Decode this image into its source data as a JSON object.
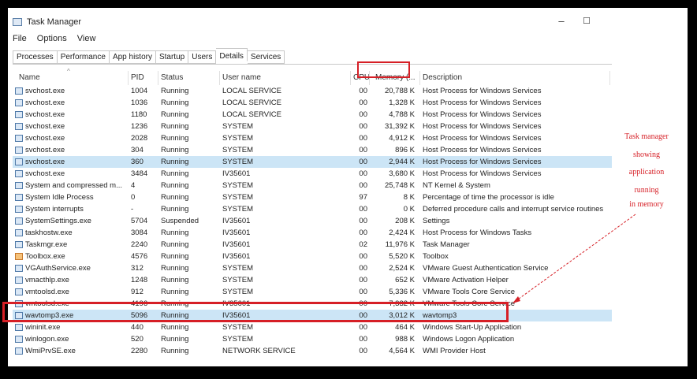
{
  "window": {
    "title": "Task Manager",
    "minimize_glyph": "–",
    "maximize_glyph": "☐"
  },
  "menu": [
    "File",
    "Options",
    "View"
  ],
  "tabs": [
    "Processes",
    "Performance",
    "App history",
    "Startup",
    "Users",
    "Details",
    "Services"
  ],
  "active_tab": "Details",
  "columns": {
    "name": "Name",
    "pid": "PID",
    "status": "Status",
    "user": "User name",
    "cpu": "CPU",
    "memory": "Memory (...",
    "description": "Description"
  },
  "rows": [
    {
      "name": "svchost.exe",
      "pid": "1004",
      "status": "Running",
      "user": "LOCAL SERVICE",
      "cpu": "00",
      "mem": "20,788 K",
      "desc": "Host Process for Windows Services"
    },
    {
      "name": "svchost.exe",
      "pid": "1036",
      "status": "Running",
      "user": "LOCAL SERVICE",
      "cpu": "00",
      "mem": "1,328 K",
      "desc": "Host Process for Windows Services"
    },
    {
      "name": "svchost.exe",
      "pid": "1180",
      "status": "Running",
      "user": "LOCAL SERVICE",
      "cpu": "00",
      "mem": "4,788 K",
      "desc": "Host Process for Windows Services"
    },
    {
      "name": "svchost.exe",
      "pid": "1236",
      "status": "Running",
      "user": "SYSTEM",
      "cpu": "00",
      "mem": "31,392 K",
      "desc": "Host Process for Windows Services"
    },
    {
      "name": "svchost.exe",
      "pid": "2028",
      "status": "Running",
      "user": "SYSTEM",
      "cpu": "00",
      "mem": "4,912 K",
      "desc": "Host Process for Windows Services"
    },
    {
      "name": "svchost.exe",
      "pid": "304",
      "status": "Running",
      "user": "SYSTEM",
      "cpu": "00",
      "mem": "896 K",
      "desc": "Host Process for Windows Services"
    },
    {
      "name": "svchost.exe",
      "pid": "360",
      "status": "Running",
      "user": "SYSTEM",
      "cpu": "00",
      "mem": "2,944 K",
      "desc": "Host Process for Windows Services",
      "selected": true
    },
    {
      "name": "svchost.exe",
      "pid": "3484",
      "status": "Running",
      "user": "IV35601",
      "cpu": "00",
      "mem": "3,680 K",
      "desc": "Host Process for Windows Services"
    },
    {
      "name": "System and compressed m...",
      "pid": "4",
      "status": "Running",
      "user": "SYSTEM",
      "cpu": "00",
      "mem": "25,748 K",
      "desc": "NT Kernel & System"
    },
    {
      "name": "System Idle Process",
      "pid": "0",
      "status": "Running",
      "user": "SYSTEM",
      "cpu": "97",
      "mem": "8 K",
      "desc": "Percentage of time the processor is idle"
    },
    {
      "name": "System interrupts",
      "pid": "-",
      "status": "Running",
      "user": "SYSTEM",
      "cpu": "00",
      "mem": "0 K",
      "desc": "Deferred procedure calls and interrupt service routines"
    },
    {
      "name": "SystemSettings.exe",
      "pid": "5704",
      "status": "Suspended",
      "user": "IV35601",
      "cpu": "00",
      "mem": "208 K",
      "desc": "Settings"
    },
    {
      "name": "taskhostw.exe",
      "pid": "3084",
      "status": "Running",
      "user": "IV35601",
      "cpu": "00",
      "mem": "2,424 K",
      "desc": "Host Process for Windows Tasks"
    },
    {
      "name": "Taskmgr.exe",
      "pid": "2240",
      "status": "Running",
      "user": "IV35601",
      "cpu": "02",
      "mem": "11,976 K",
      "desc": "Task Manager"
    },
    {
      "name": "Toolbox.exe",
      "pid": "4576",
      "status": "Running",
      "user": "IV35601",
      "cpu": "00",
      "mem": "5,520 K",
      "desc": "Toolbox",
      "icon": "orange"
    },
    {
      "name": "VGAuthService.exe",
      "pid": "312",
      "status": "Running",
      "user": "SYSTEM",
      "cpu": "00",
      "mem": "2,524 K",
      "desc": "VMware Guest Authentication Service"
    },
    {
      "name": "vmacthlp.exe",
      "pid": "1248",
      "status": "Running",
      "user": "SYSTEM",
      "cpu": "00",
      "mem": "652 K",
      "desc": "VMware Activation Helper"
    },
    {
      "name": "vmtoolsd.exe",
      "pid": "912",
      "status": "Running",
      "user": "SYSTEM",
      "cpu": "00",
      "mem": "5,336 K",
      "desc": "VMware Tools Core Service"
    },
    {
      "name": "vmtoolsd.exe",
      "pid": "4196",
      "status": "Running",
      "user": "IV35601",
      "cpu": "00",
      "mem": "7,332 K",
      "desc": "VMware Tools Core Service"
    },
    {
      "name": "wavtomp3.exe",
      "pid": "5096",
      "status": "Running",
      "user": "IV35601",
      "cpu": "00",
      "mem": "3,012 K",
      "desc": "wavtomp3",
      "selected": true
    },
    {
      "name": "wininit.exe",
      "pid": "440",
      "status": "Running",
      "user": "SYSTEM",
      "cpu": "00",
      "mem": "464 K",
      "desc": "Windows Start-Up Application"
    },
    {
      "name": "winlogon.exe",
      "pid": "520",
      "status": "Running",
      "user": "SYSTEM",
      "cpu": "00",
      "mem": "988 K",
      "desc": "Windows Logon Application"
    },
    {
      "name": "WmiPrvSE.exe",
      "pid": "2280",
      "status": "Running",
      "user": "NETWORK SERVICE",
      "cpu": "00",
      "mem": "4,564 K",
      "desc": "WMI Provider Host"
    }
  ],
  "annotation": [
    "Task manager",
    "showing",
    "application",
    "running",
    "in memory"
  ],
  "colors": {
    "highlight": "#d61f26",
    "selection": "#cce5f6"
  }
}
